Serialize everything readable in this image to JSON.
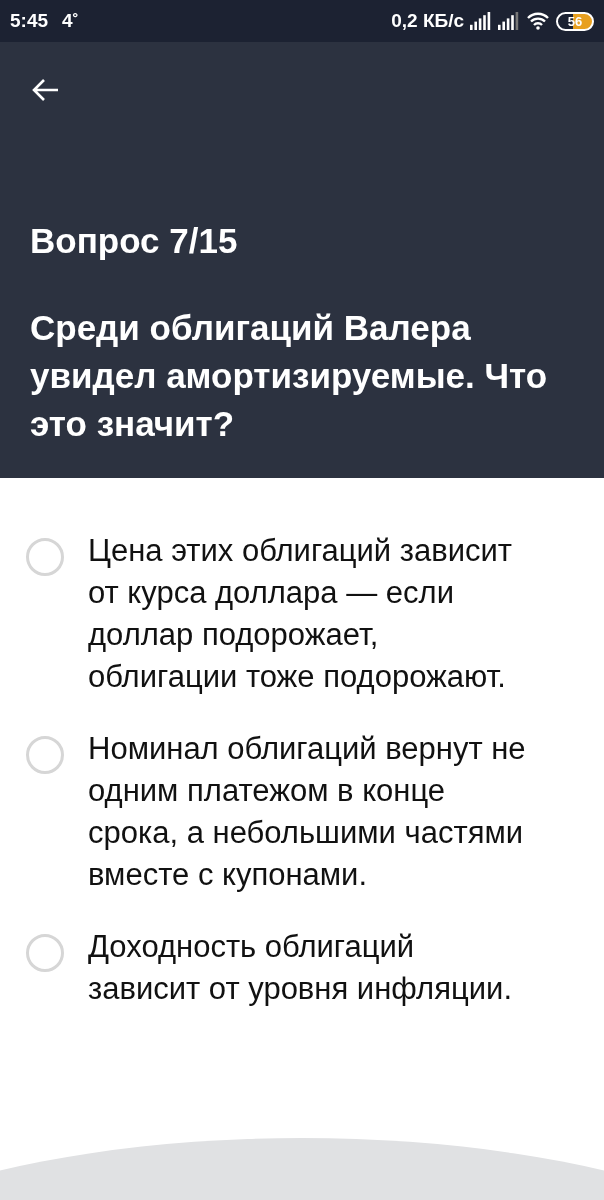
{
  "status_bar": {
    "time": "5:45",
    "temperature": "4˚",
    "network_speed": "0,2 КБ/с",
    "battery": "56"
  },
  "header": {
    "counter": "Вопрос 7/15",
    "question": "Среди облигаций Валера увидел амортизируемые. Что это значит?"
  },
  "options": [
    {
      "text": "Цена этих облигаций зависит от курса доллара — если доллар подорожает, облигации тоже подорожают.",
      "selected": false
    },
    {
      "text": "Номинал облигаций вернут не одним платежом в конце срока, а небольшими частями вместе с купонами.",
      "selected": false
    },
    {
      "text": "Доходность облигаций зависит от уровня инфляции.",
      "selected": false
    }
  ]
}
